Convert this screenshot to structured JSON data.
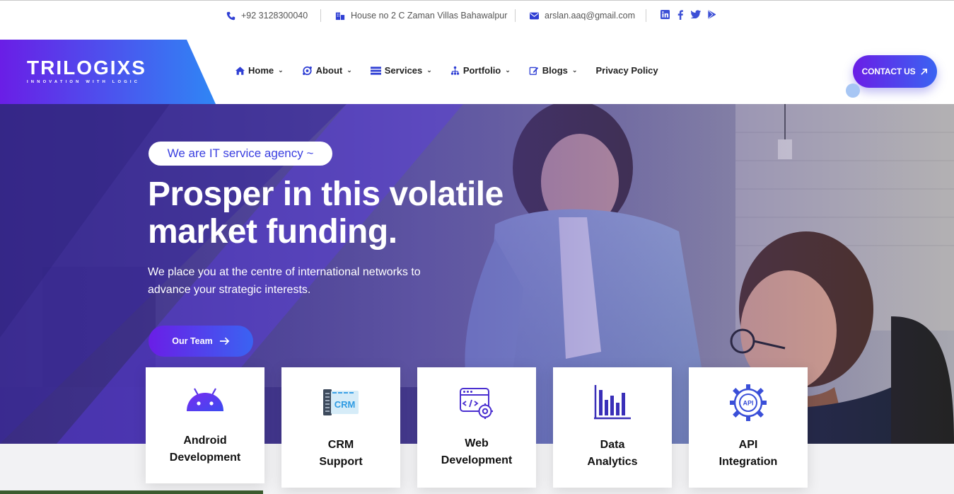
{
  "topbar": {
    "phone": "+92 3128300040",
    "address": "House no 2 C Zaman Villas Bahawalpur",
    "email": "arslan.aaq@gmail.com",
    "social_icons": [
      "linkedin-icon",
      "facebook-icon",
      "twitter-icon",
      "google-play-icon"
    ]
  },
  "brand": {
    "logo_text": "TRILOGIXS",
    "tagline": "INNOVATION WITH LOGIC"
  },
  "nav": {
    "items": [
      {
        "label": "Home",
        "icon": "home-icon",
        "has_dropdown": true
      },
      {
        "label": "About",
        "icon": "about-icon",
        "has_dropdown": true
      },
      {
        "label": "Services",
        "icon": "services-icon",
        "has_dropdown": true
      },
      {
        "label": "Portfolio",
        "icon": "portfolio-icon",
        "has_dropdown": true
      },
      {
        "label": "Blogs",
        "icon": "blog-edit-icon",
        "has_dropdown": true
      },
      {
        "label": "Privacy Policy",
        "has_dropdown": false
      }
    ],
    "cta_label": "CONTACT US"
  },
  "hero": {
    "badge": "We are IT service agency ~",
    "title_line1": "Prosper in this volatile",
    "title_line2": "market funding.",
    "subtitle": "We place you at the centre of international networks to advance your strategic interests.",
    "button_label": "Our Team"
  },
  "services": [
    {
      "line1": "Android",
      "line2": "Development",
      "icon": "android-icon"
    },
    {
      "line1": "CRM",
      "line2": "Support",
      "icon": "crm-icon",
      "icon_text": "CRM"
    },
    {
      "line1": "Web",
      "line2": "Development",
      "icon": "web-dev-icon"
    },
    {
      "line1": "Data",
      "line2": "Analytics",
      "icon": "bar-chart-icon"
    },
    {
      "line1": "API",
      "line2": "Integration",
      "icon": "api-gear-icon",
      "icon_text": "API"
    }
  ],
  "colors": {
    "accent_purple": "#6a1ee6",
    "accent_blue": "#3a63f2",
    "badge_text": "#3a3fe0",
    "icon_purple": "#4a2fd0"
  }
}
